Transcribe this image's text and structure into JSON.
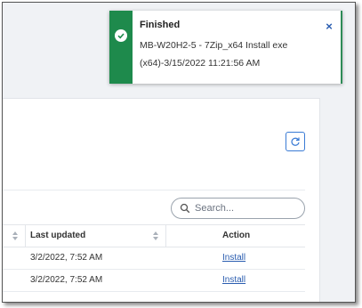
{
  "toast": {
    "title": "Finished",
    "message_line1": "MB-W20H2-5 - 7Zip_x64 Install exe",
    "message_line2": "(x64)-3/15/2022 11:21:56 AM",
    "close_glyph": "×",
    "status_color": "#1e8a4c"
  },
  "search": {
    "placeholder": "Search..."
  },
  "table": {
    "headers": {
      "last_updated": "Last updated",
      "action": "Action"
    },
    "rows": [
      {
        "last_updated": "3/2/2022, 7:52 AM",
        "action": "Install"
      },
      {
        "last_updated": "3/2/2022, 7:52 AM",
        "action": "Install"
      }
    ]
  },
  "icons": {
    "refresh": "refresh-icon",
    "search": "search-icon",
    "check": "check-circle-icon",
    "sort": "sort-icon",
    "close": "close-icon"
  },
  "colors": {
    "link": "#2a5db0",
    "accent": "#3a7bd5"
  }
}
